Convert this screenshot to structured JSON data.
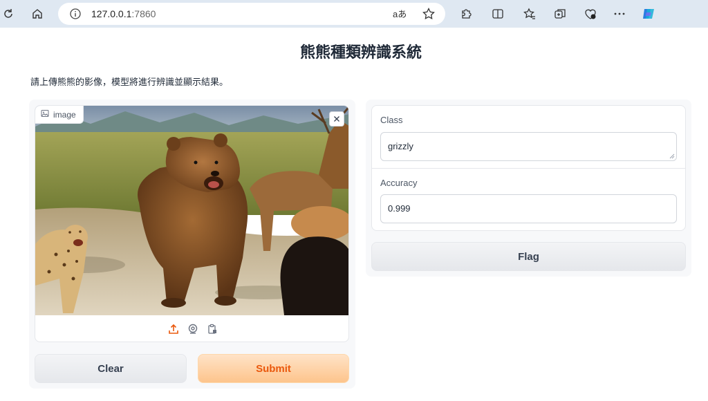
{
  "browser": {
    "url_host": "127.0.0.1",
    "url_port": ":7860",
    "read_aloud": "aあ"
  },
  "app": {
    "title": "熊熊種類辨識系統",
    "description": "請上傳熊熊的影像，模型將進行辨識並顯示結果。",
    "image_input": {
      "label": "image"
    },
    "buttons": {
      "clear": "Clear",
      "submit": "Submit",
      "flag": "Flag"
    },
    "outputs": {
      "class_label": "Class",
      "class_value": "grizzly",
      "accuracy_label": "Accuracy",
      "accuracy_value": "0.999"
    }
  },
  "colors": {
    "accent": "#ea580c",
    "chrome_bg": "#dfe8f2"
  }
}
